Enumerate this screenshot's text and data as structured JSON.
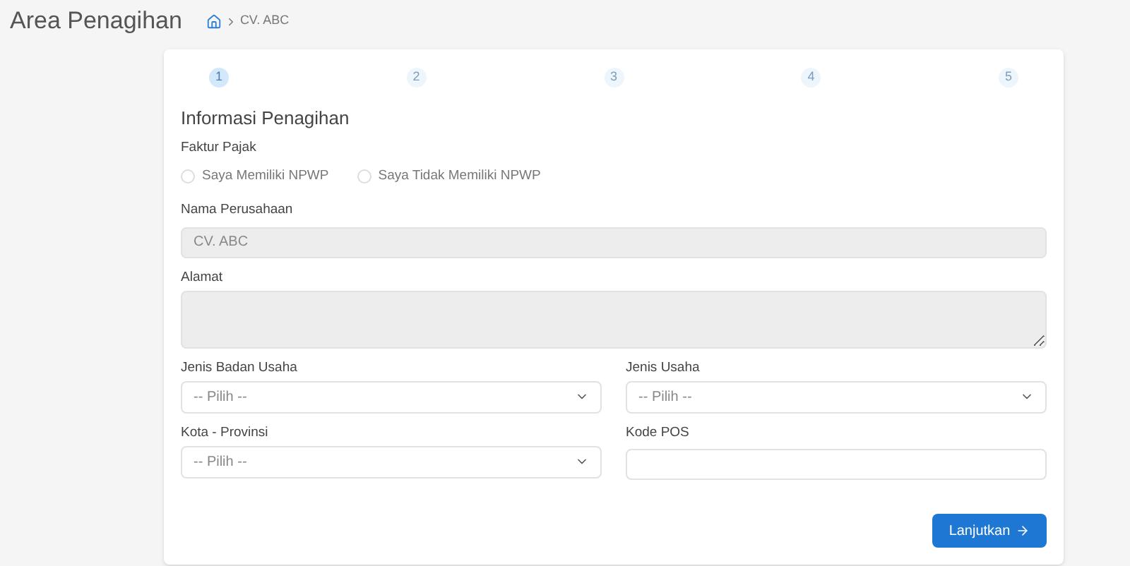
{
  "header": {
    "title": "Area Penagihan",
    "breadcrumb": "CV. ABC"
  },
  "steps": [
    {
      "label": "1",
      "selected": true
    },
    {
      "label": "2",
      "selected": false
    },
    {
      "label": "3",
      "selected": false
    },
    {
      "label": "4",
      "selected": false
    },
    {
      "label": "5",
      "selected": false
    }
  ],
  "form": {
    "title": "Informasi Penagihan",
    "faktur_pajak": {
      "label": "Faktur Pajak",
      "options": [
        {
          "label": "Saya Memiliki NPWP",
          "selected": false
        },
        {
          "label": "Saya Tidak Memiliki NPWP",
          "selected": false
        }
      ]
    },
    "fields": [
      {
        "kind": "text",
        "label": "Nama Perusahaan",
        "value": "CV. ABC",
        "disabled": true,
        "wide": true
      },
      {
        "kind": "textarea",
        "label": "Alamat",
        "disabled": true,
        "wide": true
      },
      {
        "kind": "select",
        "label": "Jenis Badan Usaha",
        "value": "-- Pilih --",
        "disabled": false,
        "wide": false
      },
      {
        "kind": "select",
        "label": "Jenis Usaha",
        "value": "-- Pilih --",
        "disabled": false,
        "wide": false
      },
      {
        "kind": "select",
        "label": "Kota - Provinsi",
        "value": "-- Pilih --",
        "disabled": false,
        "wide": false
      },
      {
        "kind": "text",
        "label": "Kode POS",
        "disabled": false,
        "wide": false
      }
    ],
    "submit": "Lanjutkan"
  }
}
